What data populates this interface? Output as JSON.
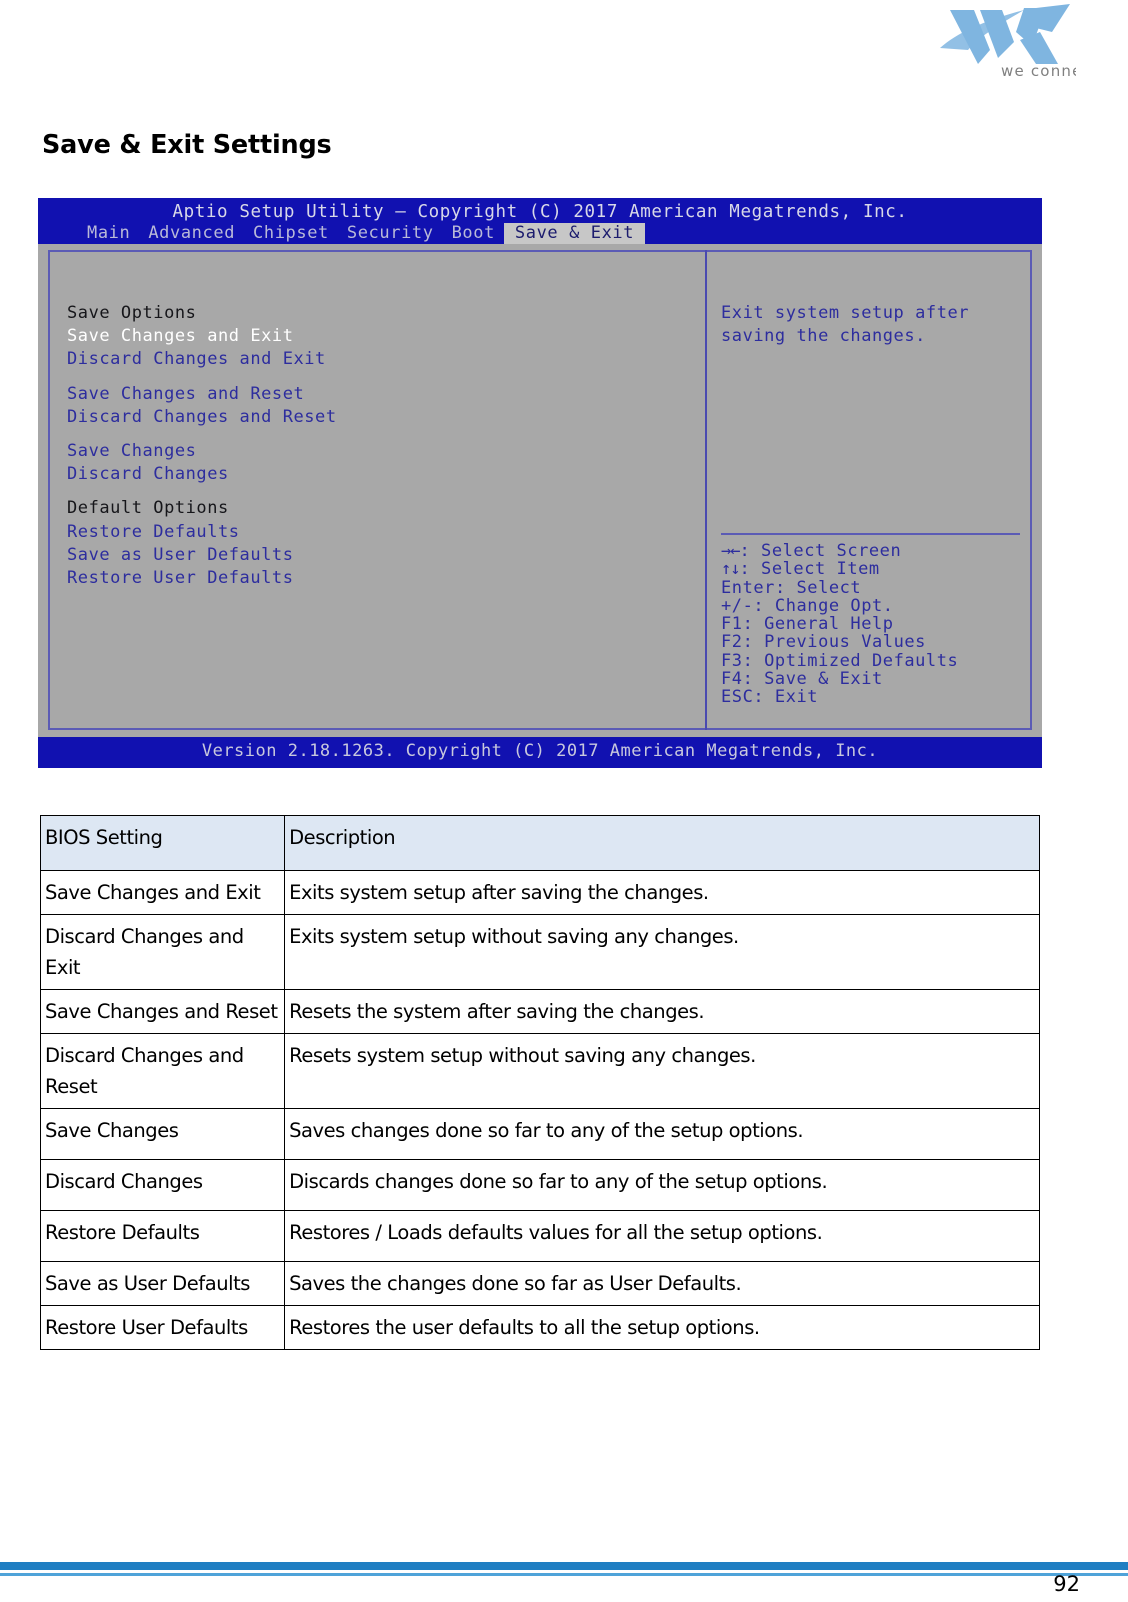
{
  "document": {
    "section_title": "Save & Exit Settings",
    "page_number": "92"
  },
  "logo": {
    "brand": "VIA",
    "tagline": "we connect",
    "brand_color": "#7fb5e0",
    "tagline_color": "#808080"
  },
  "bios": {
    "title": "Aptio Setup Utility – Copyright (C) 2017 American Megatrends, Inc.",
    "version_line": "Version 2.18.1263. Copyright (C) 2017 American Megatrends, Inc.",
    "tabs": [
      {
        "label": "Main",
        "active": false
      },
      {
        "label": "Advanced",
        "active": false
      },
      {
        "label": "Chipset",
        "active": false
      },
      {
        "label": "Security",
        "active": false
      },
      {
        "label": "Boot",
        "active": false
      },
      {
        "label": "Save & Exit",
        "active": true
      }
    ],
    "menu": [
      {
        "label": "Save Options",
        "kind": "header"
      },
      {
        "label": "Save Changes and Exit",
        "kind": "selected"
      },
      {
        "label": "Discard Changes and Exit",
        "kind": "item"
      },
      {
        "label": "",
        "kind": "spacer"
      },
      {
        "label": "Save Changes and Reset",
        "kind": "item"
      },
      {
        "label": "Discard Changes and Reset",
        "kind": "item"
      },
      {
        "label": "",
        "kind": "spacer"
      },
      {
        "label": "Save Changes",
        "kind": "item"
      },
      {
        "label": "Discard Changes",
        "kind": "item"
      },
      {
        "label": "",
        "kind": "spacer"
      },
      {
        "label": "Default Options",
        "kind": "header"
      },
      {
        "label": "Restore Defaults",
        "kind": "item"
      },
      {
        "label": "Save as User Defaults",
        "kind": "item"
      },
      {
        "label": "Restore User Defaults",
        "kind": "item"
      }
    ],
    "help_text": "Exit system setup after saving the changes.",
    "keys": [
      {
        "keys": "→←",
        "label": ": Select Screen"
      },
      {
        "keys": "↑↓",
        "label": ": Select Item"
      },
      {
        "keys": "Enter",
        "label": ": Select"
      },
      {
        "keys": "+/-",
        "label": ": Change Opt."
      },
      {
        "keys": "F1",
        "label": ": General Help"
      },
      {
        "keys": "F2",
        "label": ": Previous Values"
      },
      {
        "keys": "F3",
        "label": ": Optimized Defaults"
      },
      {
        "keys": "F4",
        "label": ": Save & Exit"
      },
      {
        "keys": "ESC",
        "label": ": Exit"
      }
    ],
    "colors": {
      "bar_blue": "#1111b0",
      "panel_gray": "#a8a8a8",
      "text_blue": "#2d2d9e",
      "selected_white": "#ffffff",
      "frame_purple": "#5b5bb5"
    }
  },
  "table": {
    "headers": [
      "BIOS Setting",
      "Description"
    ],
    "rows": [
      {
        "setting": "Save Changes and Exit",
        "description": "Exits system setup after saving the changes.",
        "size": "short"
      },
      {
        "setting": "Discard Changes and Exit",
        "description": "Exits system setup without saving any changes.",
        "size": "tall"
      },
      {
        "setting": "Save Changes and Reset",
        "description": "Resets the system after saving the changes.",
        "size": "short"
      },
      {
        "setting": "Discard Changes and Reset",
        "description": "Resets system setup without saving any changes.",
        "size": "tall"
      },
      {
        "setting": "Save Changes",
        "description": "Saves changes done so far to any of the setup options.",
        "size": "mid"
      },
      {
        "setting": "Discard Changes",
        "description": "Discards changes done so far to any of the setup options.",
        "size": "mid"
      },
      {
        "setting": "Restore Defaults",
        "description": "Restores / Loads defaults values for all the setup options.",
        "size": "mid"
      },
      {
        "setting": "Save as User Defaults",
        "description": "Saves the changes done so far as User Defaults.",
        "size": "short"
      },
      {
        "setting": "Restore User Defaults",
        "description": "Restores the user defaults to all the setup options.",
        "size": "short"
      }
    ]
  }
}
